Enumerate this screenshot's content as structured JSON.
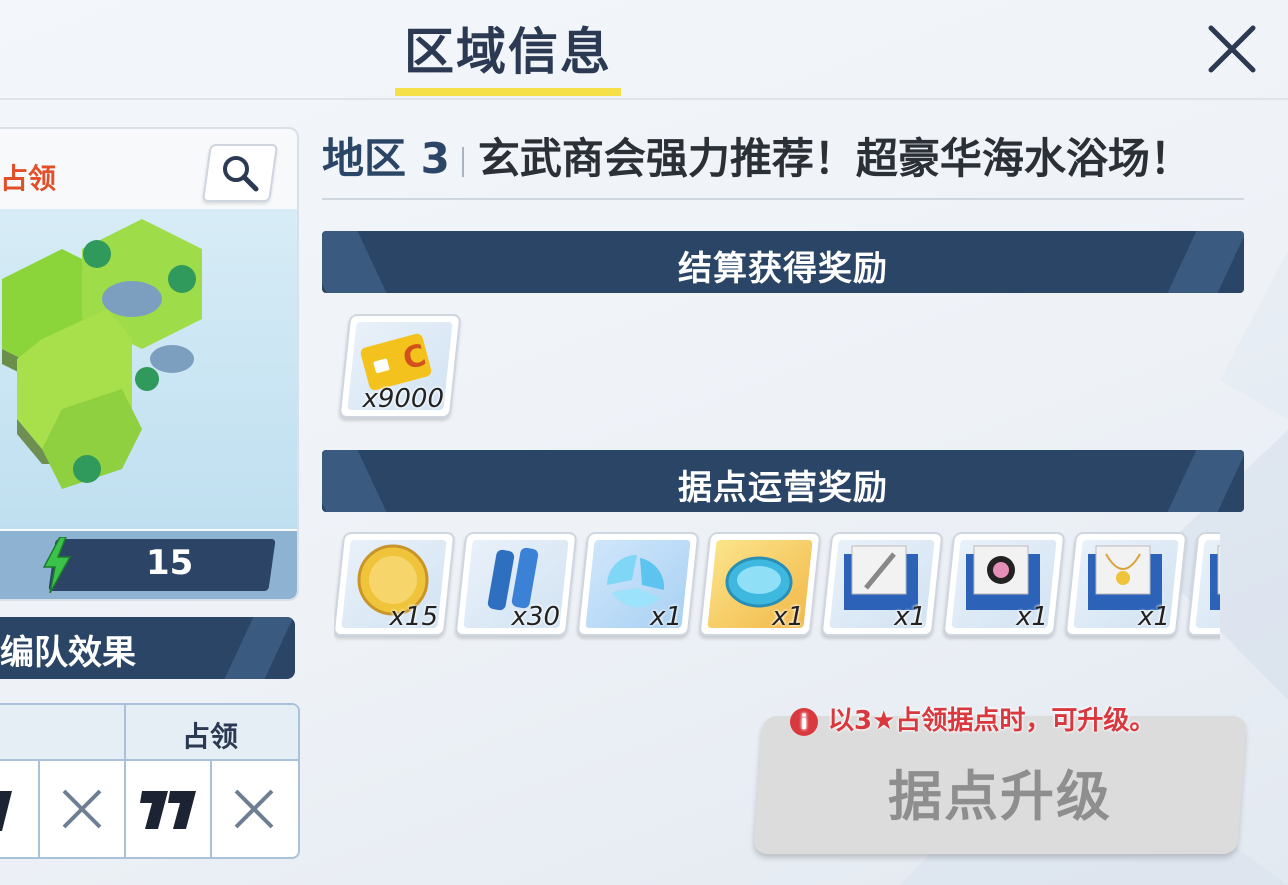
{
  "header": {
    "title": "区域信息",
    "close_icon": "close-icon"
  },
  "left_panel": {
    "occupy_label": "占领",
    "energy_value": "15",
    "formation_title": "编队效果",
    "formation_table": {
      "header_label": "占领"
    }
  },
  "region": {
    "number_label": "地区 3",
    "name": "玄武商会强力推荐！超豪华海水浴场！"
  },
  "settlement": {
    "title": "结算获得奖励",
    "items": [
      {
        "name": "card",
        "qty": "x9000"
      }
    ]
  },
  "operation": {
    "title": "据点运营奖励",
    "items": [
      {
        "name": "coin",
        "qty": "x15"
      },
      {
        "name": "scroll",
        "qty": "x30"
      },
      {
        "name": "blue-fragment",
        "qty": "x1"
      },
      {
        "name": "blue-disc",
        "qty": "x1"
      },
      {
        "name": "blueprint-tool",
        "qty": "x1"
      },
      {
        "name": "blueprint-watch",
        "qty": "x1"
      },
      {
        "name": "blueprint-necklace",
        "qty": "x1"
      }
    ]
  },
  "upgrade": {
    "notice": "以3★占领据点时，可升级。",
    "button_label": "据点升级"
  },
  "colors": {
    "navy": "#2b4566",
    "accent_yellow": "#f5e04a",
    "warning_red": "#d9383f",
    "occupy_orange": "#e2502a"
  }
}
